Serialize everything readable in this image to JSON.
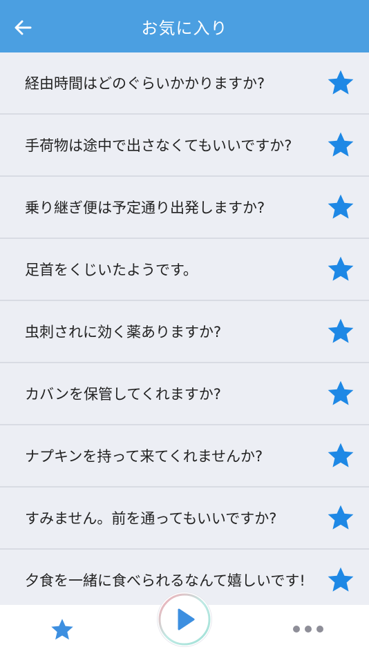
{
  "header": {
    "title": "お気に入り",
    "back_icon": "arrow-left-icon"
  },
  "colors": {
    "accent": "#4b9fe1",
    "star": "#1e88e5",
    "background": "#eceef4"
  },
  "favorites": [
    {
      "text": "経由時間はどのぐらいかかりますか?"
    },
    {
      "text": "手荷物は途中で出さなくてもいいですか?"
    },
    {
      "text": "乗り継ぎ便は予定通り出発しますか?"
    },
    {
      "text": "足首をくじいたようです。"
    },
    {
      "text": "虫刺されに効く薬ありますか?"
    },
    {
      "text": "カバンを保管してくれますか?"
    },
    {
      "text": "ナプキンを持って来てくれませんか?"
    },
    {
      "text": "すみません。前を通ってもいいですか?"
    },
    {
      "text": "夕食を一緒に食べられるなんて嬉しいです!"
    }
  ],
  "tabbar": {
    "favorites_icon": "star-icon",
    "play_icon": "play-icon",
    "more_icon": "more-dots-icon"
  }
}
